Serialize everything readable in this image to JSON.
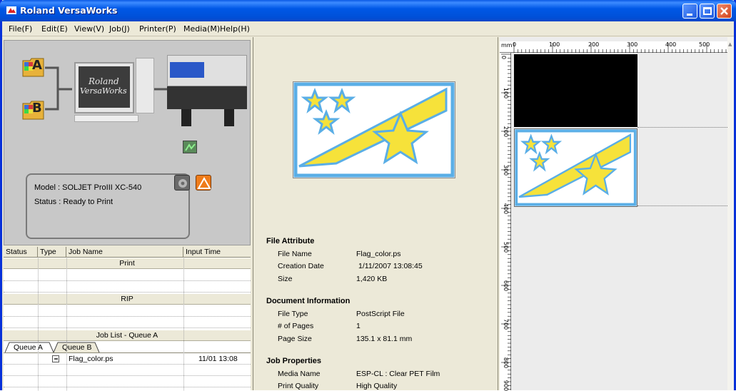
{
  "window": {
    "title": "Roland VersaWorks"
  },
  "menu": {
    "items": [
      "File(F)",
      "Edit(E)",
      "View(V)",
      "Job(J)",
      "Printer(P)",
      "Media(M)",
      "Help(H)"
    ]
  },
  "printer": {
    "queue_a": "A",
    "queue_b": "B",
    "logo_line1": "Roland",
    "logo_line2": "VersaWorks",
    "model_label": "Model : SOLJET ProIII XC-540",
    "status_label": "Status : Ready to Print"
  },
  "job_table": {
    "headers": [
      "Status",
      "Type",
      "Job Name",
      "Input Time"
    ],
    "section_print": "Print",
    "section_rip": "RIP",
    "section_joblist": "Job List - Queue A",
    "tabs": [
      "Queue A",
      "Queue B"
    ],
    "rows": [
      {
        "name": "Flag_color.ps",
        "time": "11/01 13:08"
      }
    ]
  },
  "details": {
    "file_attribute": {
      "title": "File Attribute",
      "items": [
        {
          "k": "File Name",
          "v": "Flag_color.ps"
        },
        {
          "k": "Creation Date",
          "v": "1/11/2007 13:08:45"
        },
        {
          "k": "Size",
          "v": "1,420  KB"
        }
      ]
    },
    "document_information": {
      "title": "Document Information",
      "items": [
        {
          "k": "File Type",
          "v": "PostScript File"
        },
        {
          "k": "# of Pages",
          "v": "1"
        },
        {
          "k": "Page Size",
          "v": "135.1 x 81.1 mm"
        }
      ]
    },
    "job_properties": {
      "title": "Job Properties",
      "items": [
        {
          "k": "Media Name",
          "v": "ESP-CL : Clear PET Film"
        },
        {
          "k": "Print Quality",
          "v": "High Quality"
        }
      ]
    }
  },
  "ruler": {
    "unit": "mm",
    "h_labels": [
      "0",
      "100",
      "200",
      "300",
      "400",
      "500"
    ],
    "v_labels": [
      "0",
      "100",
      "200",
      "300",
      "400",
      "500",
      "600",
      "700",
      "800",
      "900"
    ]
  },
  "colors": {
    "titlebar": "#0058e6",
    "flag_blue": "#5aaee6",
    "flag_yellow": "#f6e23a"
  }
}
